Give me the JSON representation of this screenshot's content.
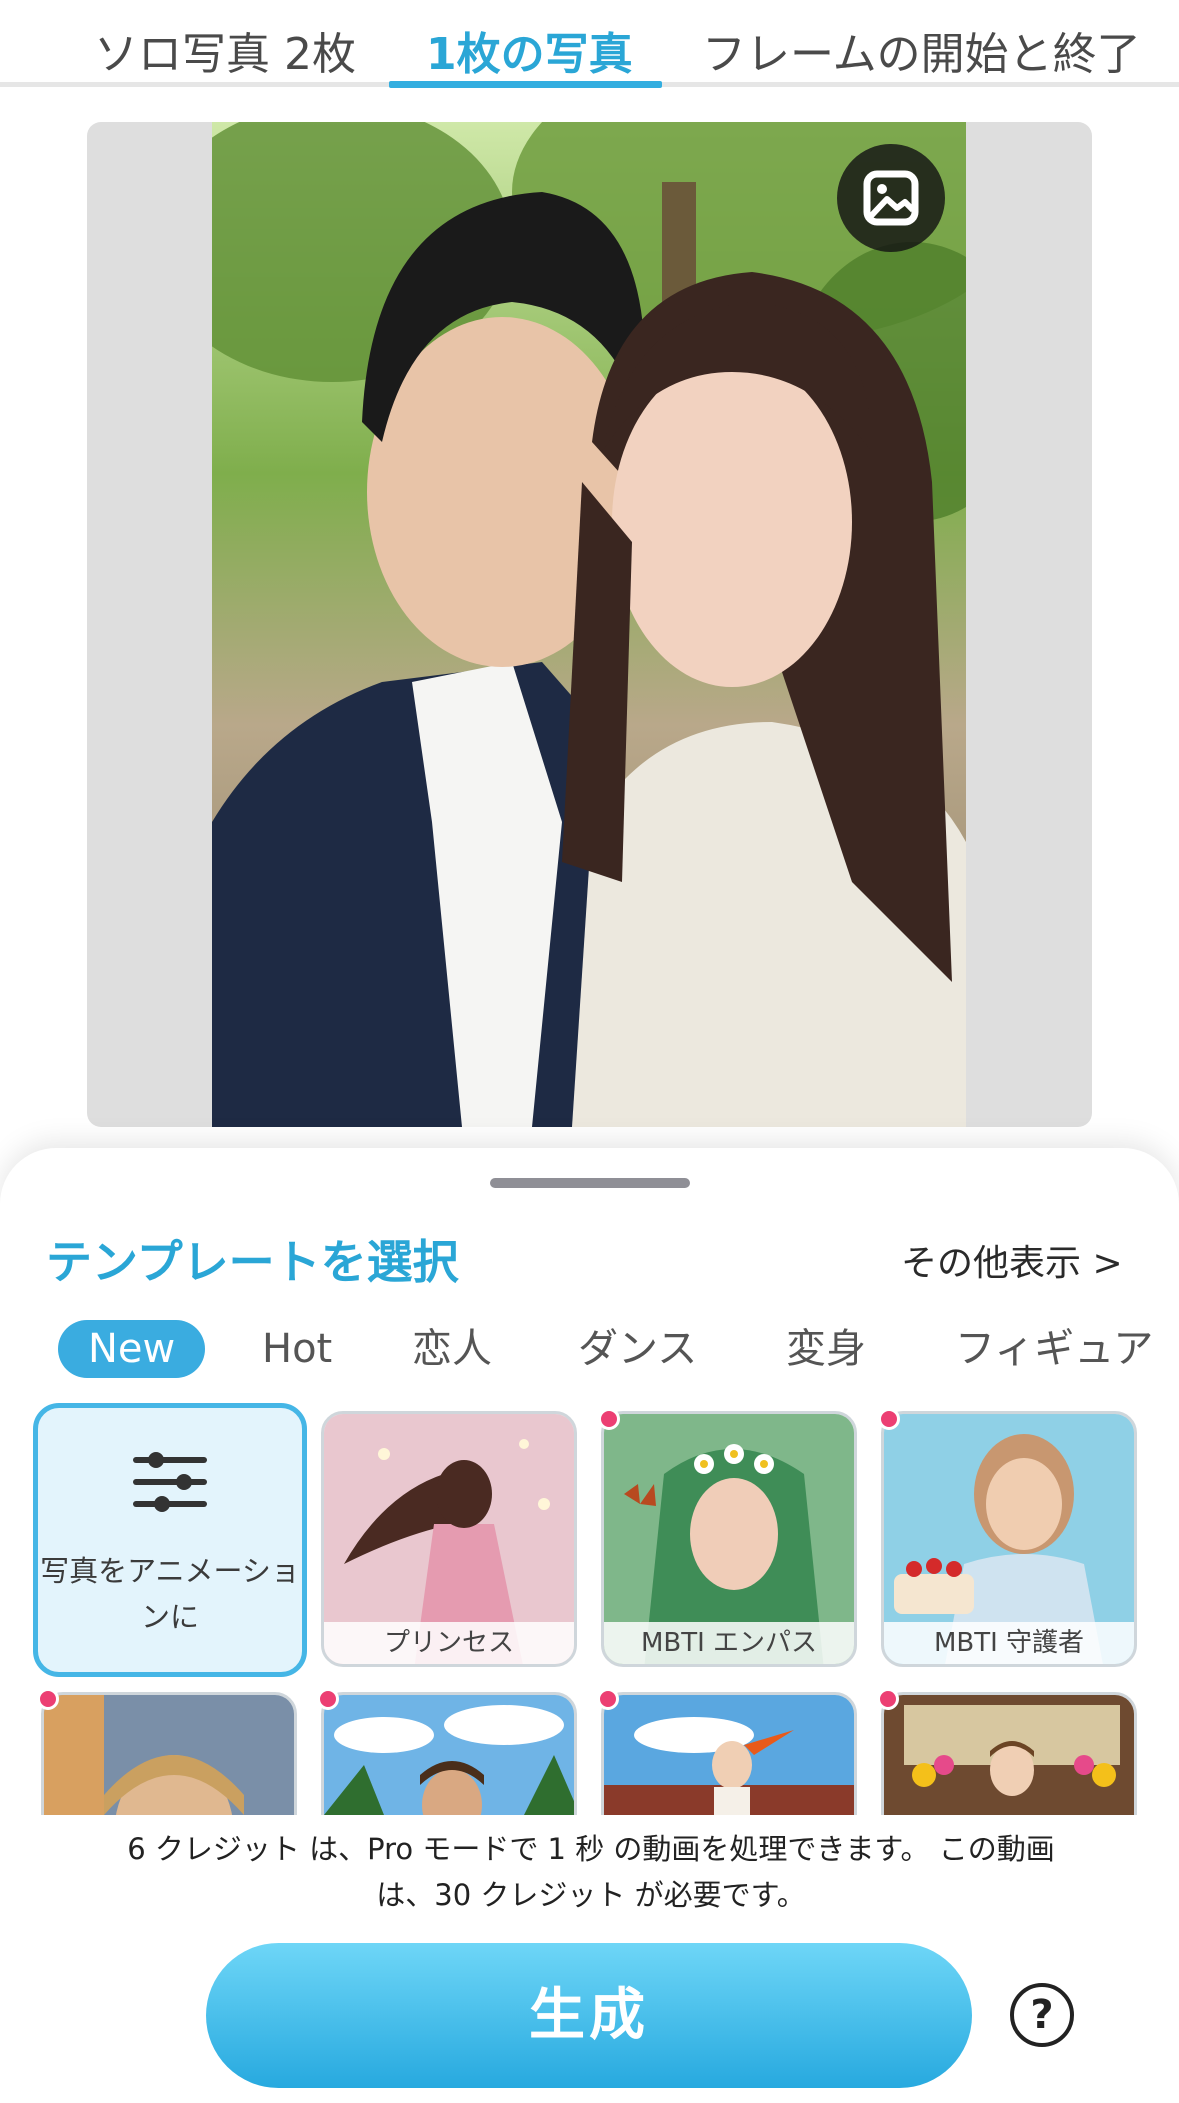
{
  "tabs": [
    {
      "label": "ソロ写真 2枚",
      "active": false
    },
    {
      "label": "1枚の写真",
      "active": true
    },
    {
      "label": "フレームの開始と終了",
      "active": false
    }
  ],
  "preview": {
    "image": "couple-selfie-in-park",
    "gallery_icon": "image-gallery-icon"
  },
  "sheet": {
    "title": "テンプレートを選択",
    "see_more": "その他表示 >"
  },
  "categories": [
    {
      "label": "New",
      "active": true
    },
    {
      "label": "Hot",
      "active": false
    },
    {
      "label": "恋人",
      "active": false
    },
    {
      "label": "ダンス",
      "active": false
    },
    {
      "label": "変身",
      "active": false
    },
    {
      "label": "フィギュア",
      "active": false
    }
  ],
  "custom_template": {
    "icon": "sliders-icon",
    "label": "写真をアニメーションに"
  },
  "templates": [
    {
      "label": "プリンセス",
      "new_dot": false
    },
    {
      "label": "MBTI エンパス",
      "new_dot": true
    },
    {
      "label": "MBTI 守護者",
      "new_dot": true
    },
    {
      "label": "",
      "new_dot": true
    },
    {
      "label": "",
      "new_dot": true
    },
    {
      "label": "",
      "new_dot": true
    },
    {
      "label": "",
      "new_dot": true
    }
  ],
  "footer": {
    "credit_line1": "6 クレジット は、Pro モードで 1 秒 の動画を処理できます。 この動画",
    "credit_line2": "は、30 クレジット が必要です。",
    "generate_label": "生成",
    "help_icon": "help-circle-icon",
    "help_glyph": "?"
  },
  "colors": {
    "accent": "#2AA6D6",
    "new_dot": "#EC3F73",
    "generate_gradient_top": "#6ED6F7",
    "generate_gradient_bottom": "#27A9DF"
  }
}
